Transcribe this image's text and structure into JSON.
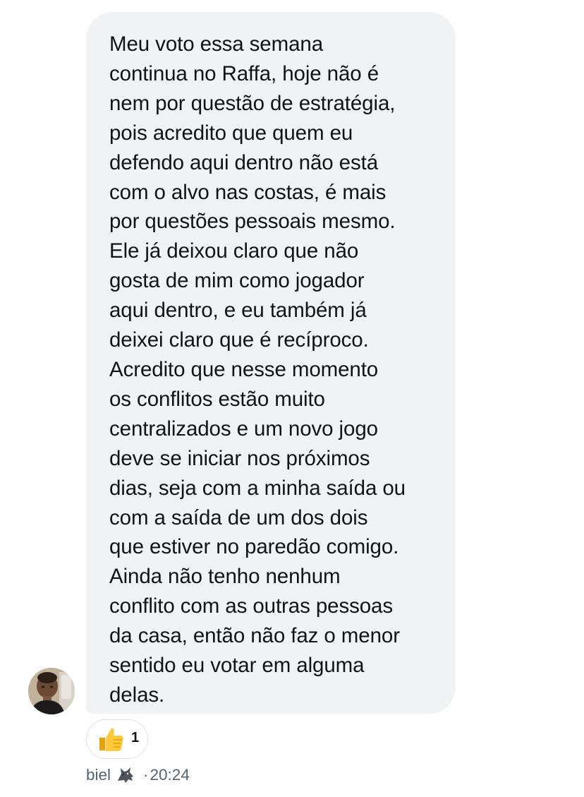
{
  "message": {
    "lines": [
      "Meu voto essa semana",
      "continua no Raffa, hoje não é",
      "nem por questão de estratégia,",
      "pois acredito que quem eu",
      "defendo aqui dentro não está",
      "com o alvo nas costas, é mais",
      "por questões pessoais mesmo.",
      "Ele já deixou claro que não",
      "gosta de mim como jogador",
      "aqui dentro, e eu também já",
      "deixei claro que é recíproco.",
      "Acredito que nesse momento",
      "os conflitos estão muito",
      "centralizados e um novo jogo",
      "deve se iniciar nos próximos",
      "dias, seja com a minha saída ou",
      "com a saída de um dos dois",
      "que estiver no paredão comigo.",
      "Ainda não tenho nenhum",
      "conflito com as outras pessoas",
      "da casa, então não faz o menor",
      "sentido eu votar em alguma",
      "delas."
    ]
  },
  "reaction": {
    "emoji": "thumbs-up-icon",
    "count": "1"
  },
  "meta": {
    "sender": "biel",
    "sender_emoji": "wolf-icon",
    "separator": "·",
    "time": "20:24"
  },
  "colors": {
    "bubble_bg": "#eff3f4",
    "text": "#0f1419",
    "meta_text": "#536471",
    "reaction_border": "#dfe4e7"
  }
}
